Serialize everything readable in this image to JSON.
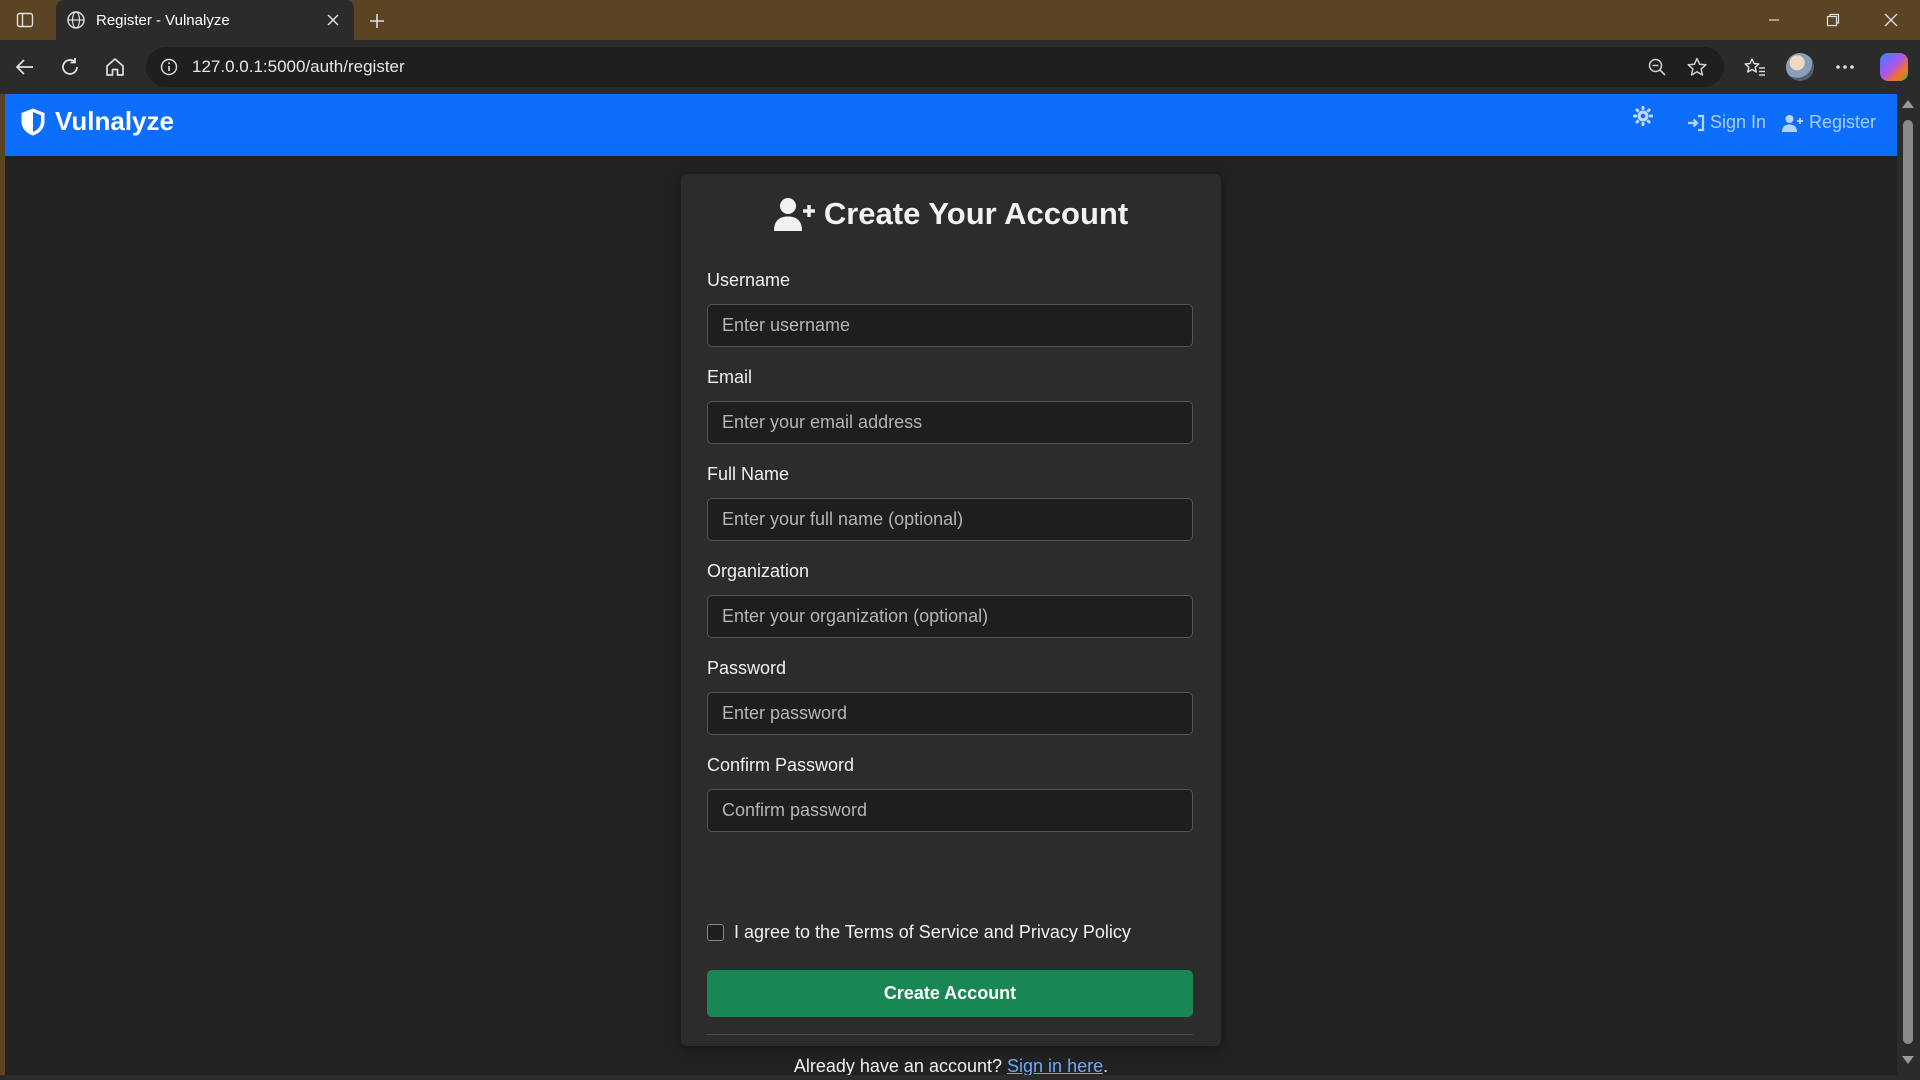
{
  "browser": {
    "tab_title": "Register - Vulnalyze",
    "url": "127.0.0.1:5000/auth/register",
    "icons": [
      "sidebar-icon",
      "globe-icon",
      "close-icon",
      "plus-icon",
      "minimize-icon",
      "restore-icon",
      "window-close-icon",
      "back-icon",
      "reload-icon",
      "home-icon",
      "info-icon",
      "zoom-out-icon",
      "star-icon",
      "favorites-icon",
      "profile-avatar",
      "more-icon",
      "copilot-icon"
    ]
  },
  "header": {
    "brand": "Vulnalyze",
    "sign_in": "Sign In",
    "register": "Register",
    "icons": [
      "shield-icon",
      "gear-icon",
      "sign-in-icon",
      "user-plus-icon"
    ]
  },
  "form": {
    "title": "Create Your Account",
    "fields": [
      {
        "label": "Username",
        "placeholder": "Enter username",
        "value": ""
      },
      {
        "label": "Email",
        "placeholder": "Enter your email address",
        "value": ""
      },
      {
        "label": "Full Name",
        "placeholder": "Enter your full name (optional)",
        "value": ""
      },
      {
        "label": "Organization",
        "placeholder": "Enter your organization (optional)",
        "value": ""
      },
      {
        "label": "Password",
        "placeholder": "Enter password",
        "value": ""
      },
      {
        "label": "Confirm Password",
        "placeholder": "Confirm password",
        "value": ""
      }
    ],
    "terms": "I agree to the Terms of Service and Privacy Policy",
    "terms_checked": false,
    "submit": "Create Account",
    "footer_prefix": "Already have an account?",
    "footer_link": "Sign in here",
    "footer_suffix": "."
  },
  "colors": {
    "header_bg": "#0d6efd",
    "submit_bg": "#198754",
    "link": "#6ea8fe",
    "page_bg": "#212121",
    "card_bg": "#2c2c2c",
    "browser_frame": "#5b4424"
  }
}
